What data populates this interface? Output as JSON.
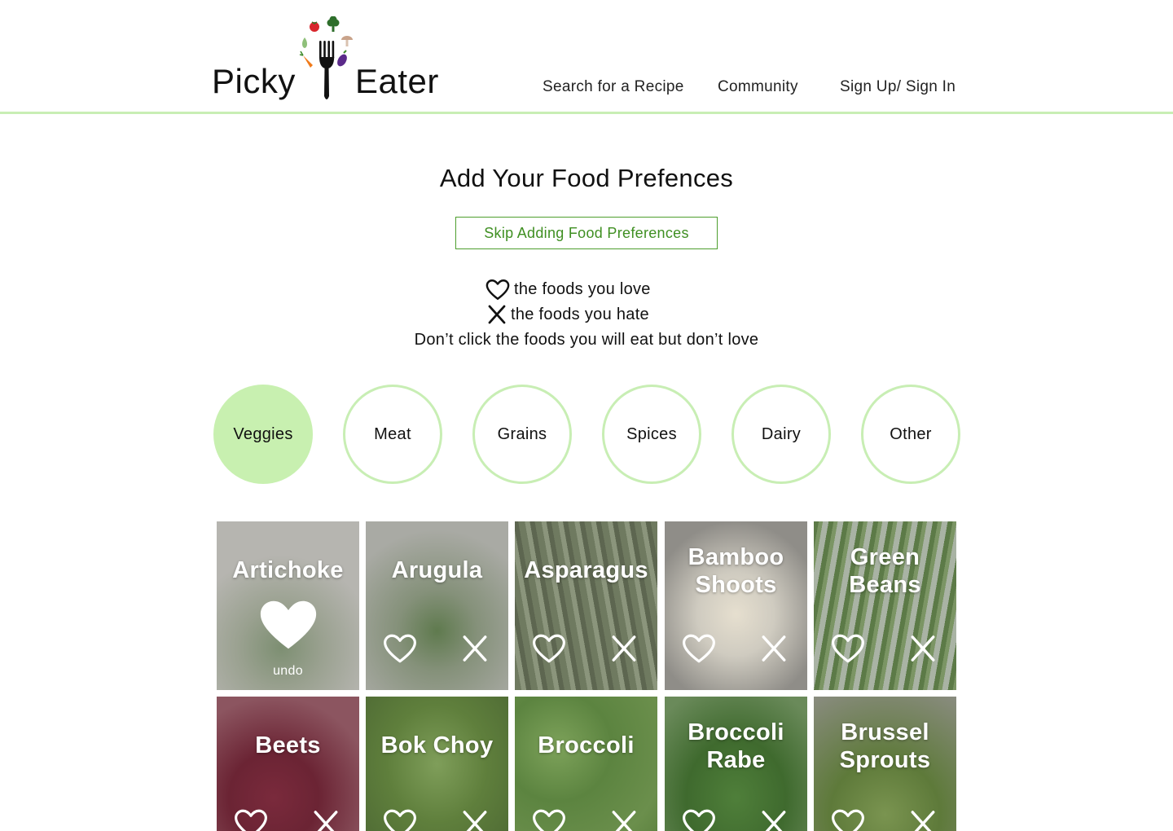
{
  "brand": {
    "left_word": "Picky",
    "right_word": "Eater"
  },
  "nav": {
    "search": "Search for a Recipe",
    "community": "Community",
    "signin": "Sign Up/ Sign In"
  },
  "page": {
    "title": "Add Your Food Prefences",
    "skip_label": "Skip Adding Food Preferences",
    "love_text": "the foods you love",
    "hate_text": "the foods you hate",
    "note": "Don’t click the foods you will eat but don’t love"
  },
  "categories": [
    {
      "label": "Veggies",
      "active": true
    },
    {
      "label": "Meat",
      "active": false
    },
    {
      "label": "Grains",
      "active": false
    },
    {
      "label": "Spices",
      "active": false
    },
    {
      "label": "Dairy",
      "active": false
    },
    {
      "label": "Other",
      "active": false
    }
  ],
  "foods": [
    {
      "name_lines": [
        "Artichoke"
      ],
      "loved": true,
      "undo_label": "undo"
    },
    {
      "name_lines": [
        "Arugula"
      ]
    },
    {
      "name_lines": [
        "Asparagus"
      ]
    },
    {
      "name_lines": [
        "Bamboo",
        "Shoots"
      ]
    },
    {
      "name_lines": [
        "Green",
        "Beans"
      ]
    },
    {
      "name_lines": [
        "Beets"
      ]
    },
    {
      "name_lines": [
        "Bok Choy"
      ]
    },
    {
      "name_lines": [
        "Broccoli"
      ]
    },
    {
      "name_lines": [
        "Broccoli",
        "Rabe"
      ]
    },
    {
      "name_lines": [
        "Brussel",
        "Sprouts"
      ]
    }
  ],
  "colors": {
    "accent_green": "#c8eeb4",
    "active_category": "#c8f0b0",
    "skip_green": "#3f8f22"
  }
}
